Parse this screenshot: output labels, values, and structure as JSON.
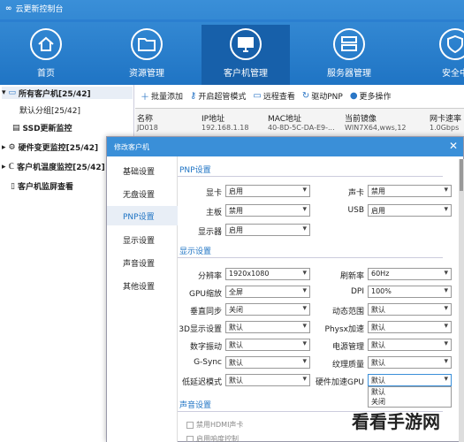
{
  "app": {
    "logo": "∞",
    "title": "云更新控制台"
  },
  "nav": [
    {
      "label": "首页"
    },
    {
      "label": "资源管理"
    },
    {
      "label": "客户机管理"
    },
    {
      "label": "服务器管理"
    },
    {
      "label": "安全中"
    }
  ],
  "tree": {
    "root": "所有客户机[25/42]",
    "default_group": "默认分组[25/42]",
    "ssd": "SSD更新监控",
    "hardware": "硬件变更监控[25/42]",
    "temp": "客户机温度监控[25/42]",
    "screen": "客户机监屏查看"
  },
  "toolbar": {
    "batch_add": "批量添加",
    "super_mode": "开启超管模式",
    "remote": "远程查看",
    "pnp": "驱动PNP",
    "more": "更多操作"
  },
  "table": {
    "headers": [
      "名称",
      "IP地址",
      "MAC地址",
      "当前镜像",
      "网卡速率"
    ],
    "row1": [
      "JD018",
      "192.168.1.18",
      "40-8D-5C-DA-E9-...",
      "WIN7X64,wws,12",
      "1.0Gbps"
    ]
  },
  "modal": {
    "title": "修改客户机",
    "tabs": [
      "基础设置",
      "无盘设置",
      "PNP设置",
      "显示设置",
      "声音设置",
      "其他设置"
    ],
    "pnp_section": "PNP设置",
    "pnp": [
      {
        "label": "显卡",
        "value": "启用"
      },
      {
        "label": "声卡",
        "value": "禁用"
      },
      {
        "label": "主板",
        "value": "禁用"
      },
      {
        "label": "USB",
        "value": "启用"
      },
      {
        "label": "显示器",
        "value": "启用"
      }
    ],
    "display_section": "显示设置",
    "display": [
      {
        "label": "分辨率",
        "value": "1920x1080"
      },
      {
        "label": "刷新率",
        "value": "60Hz"
      },
      {
        "label": "GPU缩放",
        "value": "全屏"
      },
      {
        "label": "DPI",
        "value": "100%"
      },
      {
        "label": "垂直同步",
        "value": "关闭"
      },
      {
        "label": "动态范围",
        "value": "默认"
      },
      {
        "label": "3D显示设置",
        "value": "默认"
      },
      {
        "label": "Physx加速",
        "value": "默认"
      },
      {
        "label": "数字振动",
        "value": "默认"
      },
      {
        "label": "电源管理",
        "value": "默认"
      },
      {
        "label": "G-Sync",
        "value": "默认"
      },
      {
        "label": "纹理质量",
        "value": "默认"
      },
      {
        "label": "低延迟模式",
        "value": "默认"
      },
      {
        "label": "硬件加速GPU",
        "value": "默认"
      }
    ],
    "dropdown_options": [
      "默认",
      "关闭"
    ],
    "sound_section": "声音设置",
    "sound": [
      "禁用HDMI声卡",
      "启用响度控制"
    ]
  },
  "watermark": "看看手游网"
}
